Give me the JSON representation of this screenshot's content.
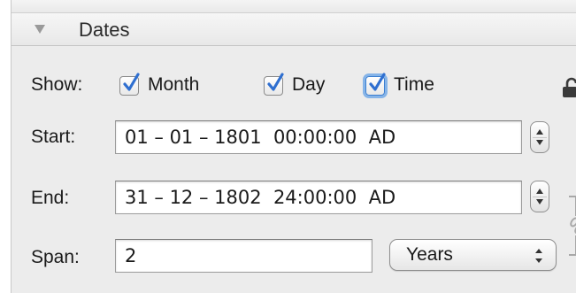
{
  "section": {
    "title": "Dates",
    "expanded": true
  },
  "show": {
    "label": "Show:",
    "options": [
      {
        "label": "Month",
        "checked": true
      },
      {
        "label": "Day",
        "checked": true
      },
      {
        "label": "Time",
        "checked": true,
        "focused": true
      }
    ]
  },
  "start": {
    "label": "Start:",
    "value": "01 – 01 – 1801  00:00:00  AD"
  },
  "end": {
    "label": "End:",
    "value": "31 – 12 – 1802  24:00:00  AD"
  },
  "span": {
    "label": "Span:",
    "value": "2",
    "unit": "Years"
  },
  "icons": {
    "disclosure": "disclosure-triangle-down-icon",
    "lock": "lock-open-icon",
    "stepper": "stepper-icon",
    "popup_arrows": "popup-arrows-icon",
    "link": "chain-link-icon"
  },
  "colors": {
    "accent": "#2f6fd0",
    "panel": "#ececec"
  }
}
